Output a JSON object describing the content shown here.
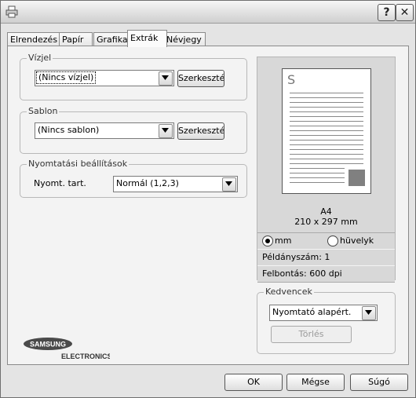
{
  "titlebar": {
    "help_label": "?",
    "close_label": "✕"
  },
  "tabs": [
    {
      "label": "Elrendezés"
    },
    {
      "label": "Papír"
    },
    {
      "label": "Grafika"
    },
    {
      "label": "Extrák",
      "active": true
    },
    {
      "label": "Névjegy"
    }
  ],
  "watermark": {
    "group_label": "Vízjel",
    "selected": "(Nincs vízjel)",
    "edit_button": "Szerkesztés"
  },
  "overlay": {
    "group_label": "Sablon",
    "selected": "(Nincs sablon)",
    "edit_button": "Szerkesztés"
  },
  "print_options": {
    "group_label": "Nyomtatási beállítások",
    "field_label": "Nyomt. tart.",
    "selected": "Normál (1,2,3)"
  },
  "preview": {
    "page_letter": "S",
    "paper_size": "A4",
    "dimensions": "210 x 297 mm",
    "unit_mm": "mm",
    "unit_inch": "hüvelyk",
    "selected_unit": "mm",
    "copies": "Példányszám: 1",
    "resolution": "Felbontás: 600 dpi"
  },
  "favorites": {
    "group_label": "Kedvencek",
    "selected": "Nyomtató alapért.",
    "delete_button": "Törlés"
  },
  "logo": {
    "brand": "SAMSUNG",
    "sub": "ELECTRONICS"
  },
  "footer": {
    "ok": "OK",
    "cancel": "Mégse",
    "help": "Súgó"
  }
}
